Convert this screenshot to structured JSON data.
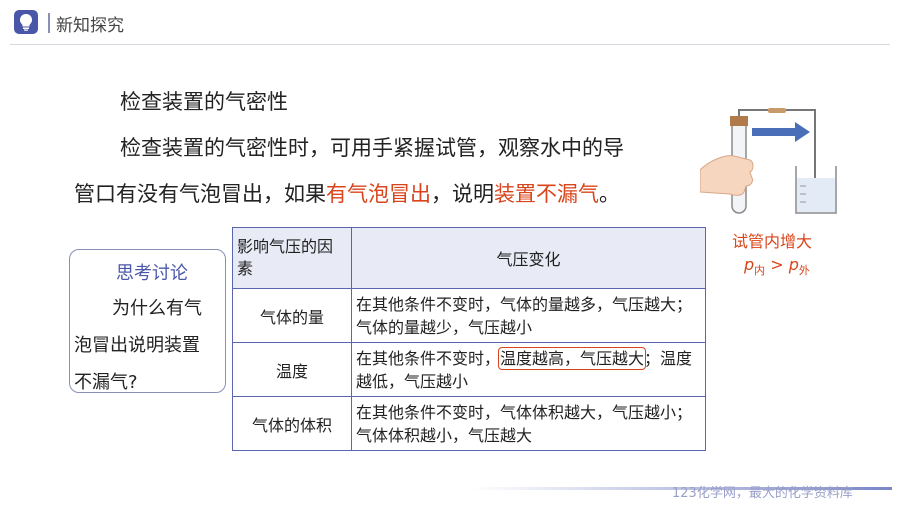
{
  "header": {
    "title": "新知探究",
    "icon": "lightbulb-icon"
  },
  "content": {
    "title": "检查装置的气密性",
    "line1": "检查装置的气密性时，可用手紧握试管，观察水中的导",
    "line2_a": "管口有没有气泡冒出，如果",
    "line2_red1": "有气泡冒出",
    "line2_b": "，说明",
    "line2_red2": "装置不漏气",
    "line2_c": "。"
  },
  "think": {
    "title": "思考讨论",
    "q1": "为什么有气",
    "q2": "泡冒出说明装置",
    "q3": "不漏气?"
  },
  "table": {
    "headers": [
      "影响气压的因素",
      "气压变化"
    ],
    "rows": [
      {
        "factor": "气体的量",
        "change": "在其他条件不变时，气体的量越多，气压越大；气体的量越少，气压越小"
      },
      {
        "factor": "温度",
        "change_a": "在其他条件不变时，",
        "change_hl": "温度越高，气压越大",
        "change_b": "；温度越低，气压越小"
      },
      {
        "factor": "气体的体积",
        "change": "在其他条件不变时，气体体积越大，气压越小；气体体积越小，气压越大"
      }
    ]
  },
  "apparatus": {
    "caption1": "试管内增大",
    "p_left": "p",
    "sub_left": "内",
    "gt": " > ",
    "p_right": "p",
    "sub_right": "外"
  },
  "footer": {
    "watermark": "123化学网，最大的化学资料库"
  },
  "colors": {
    "accent": "#4a57a8",
    "highlight": "#d9441a",
    "header_bg": "#e8eaf5"
  }
}
